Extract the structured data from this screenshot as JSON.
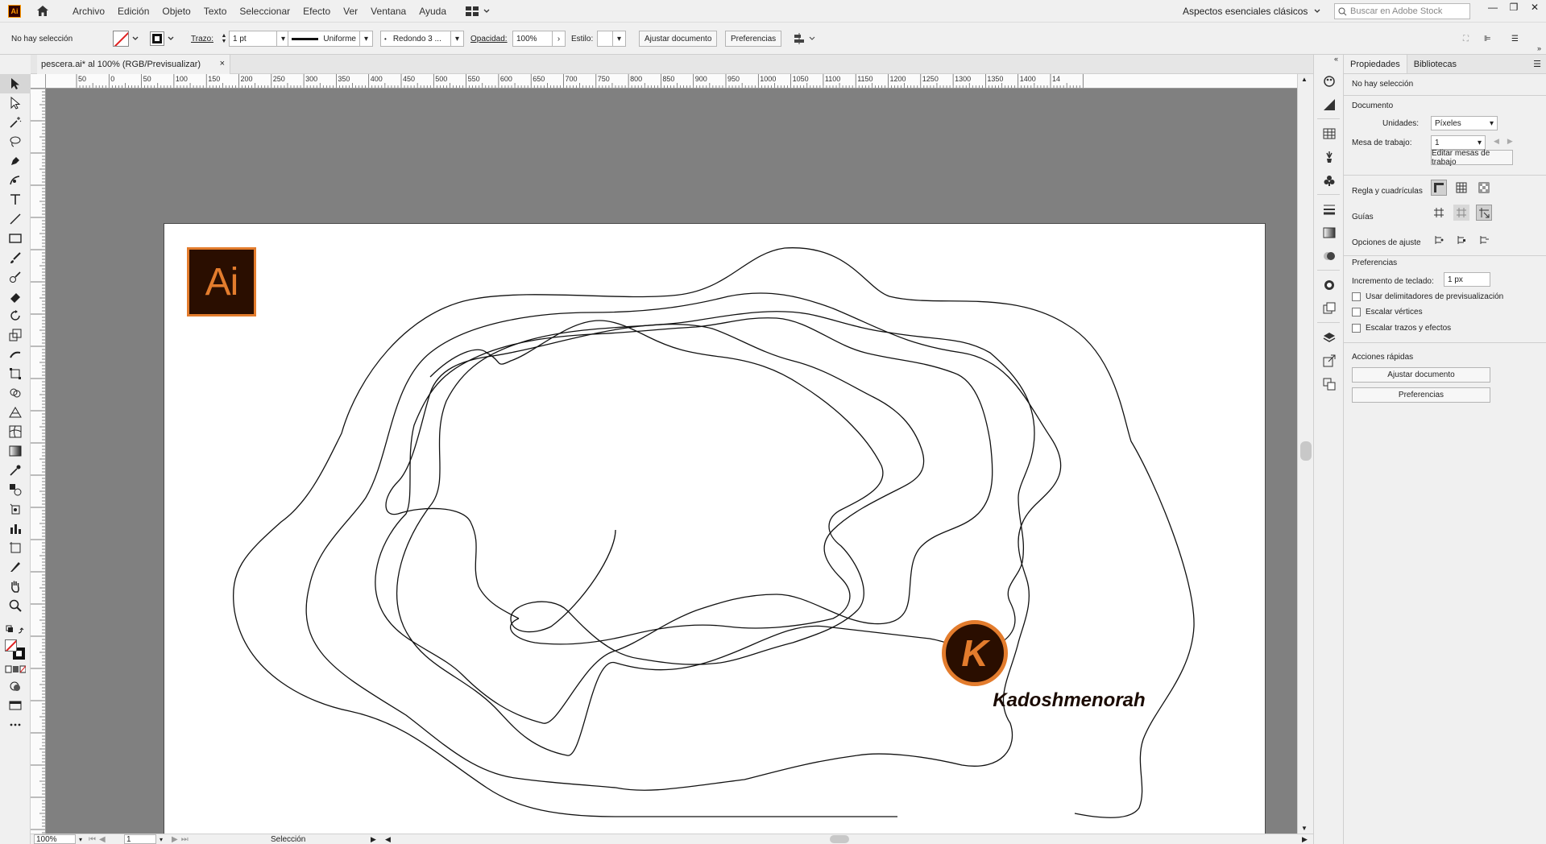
{
  "menubar": {
    "logo": "Ai",
    "items": [
      "Archivo",
      "Edición",
      "Objeto",
      "Texto",
      "Seleccionar",
      "Efecto",
      "Ver",
      "Ventana",
      "Ayuda"
    ],
    "workspace": "Aspectos esenciales clásicos",
    "search_placeholder": "Buscar en Adobe Stock"
  },
  "control": {
    "selection": "No hay selección",
    "stroke_label": "Trazo:",
    "stroke_value": "1 pt",
    "profile": "Uniforme",
    "brush": "Redondo 3 ...",
    "opacity_label": "Opacidad:",
    "opacity_value": "100%",
    "style_label": "Estilo:",
    "fit_doc": "Ajustar documento",
    "prefs": "Preferencias"
  },
  "doc_tab": {
    "title": "pescera.ai* al 100% (RGB/Previsualizar)",
    "close": "×"
  },
  "ruler": {
    "h_labels": [
      "50",
      "0",
      "50",
      "100",
      "150",
      "200",
      "250",
      "300",
      "350",
      "400",
      "450",
      "500",
      "550",
      "600",
      "650",
      "700",
      "750",
      "800",
      "850",
      "900",
      "950",
      "1000",
      "1050",
      "1100",
      "1150",
      "1200",
      "1250",
      "1300",
      "1350",
      "1400",
      "14"
    ]
  },
  "artboard": {
    "logo_text": "Ai",
    "brand_letter": "K",
    "brand_name": "Kadoshmenorah"
  },
  "status": {
    "zoom": "100%",
    "page": "1",
    "tool": "Selección"
  },
  "panel": {
    "tab_props": "Propiedades",
    "tab_libs": "Bibliotecas",
    "no_selection": "No hay selección",
    "document": "Documento",
    "units_label": "Unidades:",
    "units_value": "Píxeles",
    "artboard_label": "Mesa de trabajo:",
    "artboard_value": "1",
    "edit_artboards": "Editar mesas de trabajo",
    "rulers_grids": "Regla y cuadrículas",
    "guides": "Guías",
    "snap_options": "Opciones de ajuste",
    "preferences": "Preferencias",
    "keyboard_inc_label": "Incremento de teclado:",
    "keyboard_inc_value": "1 px",
    "chk_preview_bounds": "Usar delimitadores de previsualización",
    "chk_scale_corners": "Escalar vértices",
    "chk_scale_strokes": "Escalar trazos y efectos",
    "quick_actions": "Acciones rápidas",
    "qa_fit": "Ajustar documento",
    "qa_prefs": "Preferencias"
  },
  "colors": {
    "ai_bg": "#2a0e00",
    "ai_orange": "#e37c2d",
    "canvas": "#808080"
  }
}
